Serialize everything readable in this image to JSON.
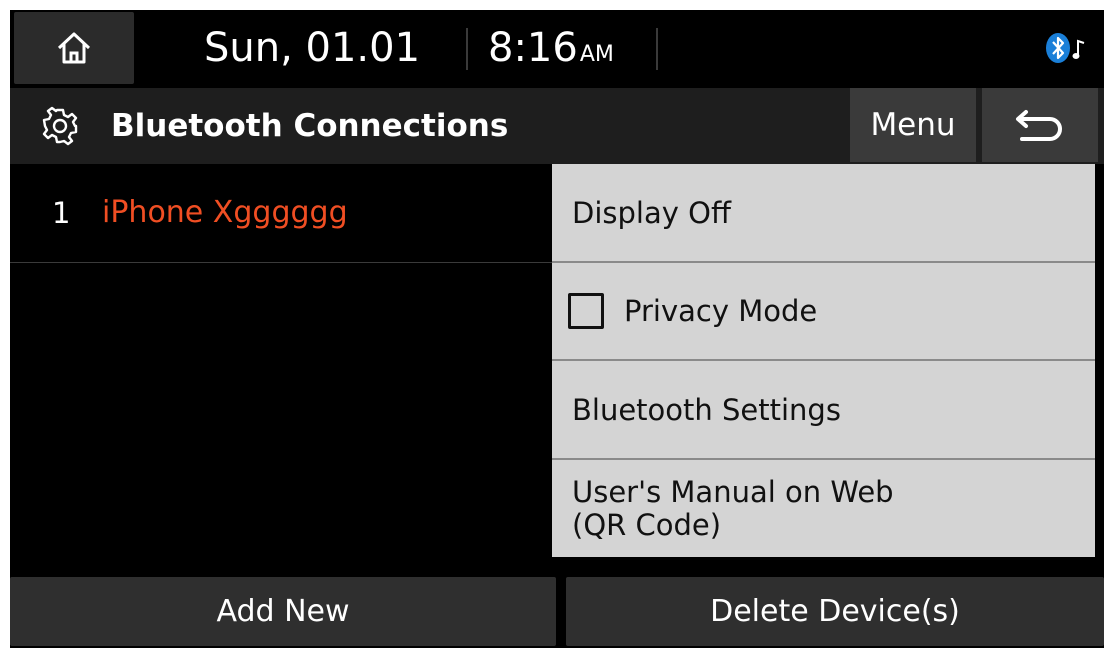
{
  "status": {
    "date": "Sun, 01.01",
    "time": "8:16",
    "ampm": "AM",
    "icons": [
      "home-icon",
      "bluetooth-audio-icon"
    ]
  },
  "header": {
    "title": "Bluetooth Connections",
    "menu_label": "Menu",
    "icons": [
      "gear-icon",
      "back-icon"
    ]
  },
  "devices": [
    {
      "index": "1",
      "name": "iPhone Xgggggg"
    }
  ],
  "menu": {
    "items": [
      {
        "label": "Display Off"
      },
      {
        "label": "Privacy Mode",
        "checked": false
      },
      {
        "label": "Bluetooth Settings"
      },
      {
        "label_line1": "User's Manual on Web",
        "label_line2": "(QR Code)"
      }
    ]
  },
  "footer": {
    "add_label": "Add New",
    "delete_label": "Delete Device(s)"
  },
  "colors": {
    "background": "#000000",
    "bar": "#1e1e1e",
    "button": "#3a3a3a",
    "menu_bg": "#d4d4d4",
    "accent_device": "#f04e23",
    "bluetooth_blue": "#1a7fd8"
  }
}
